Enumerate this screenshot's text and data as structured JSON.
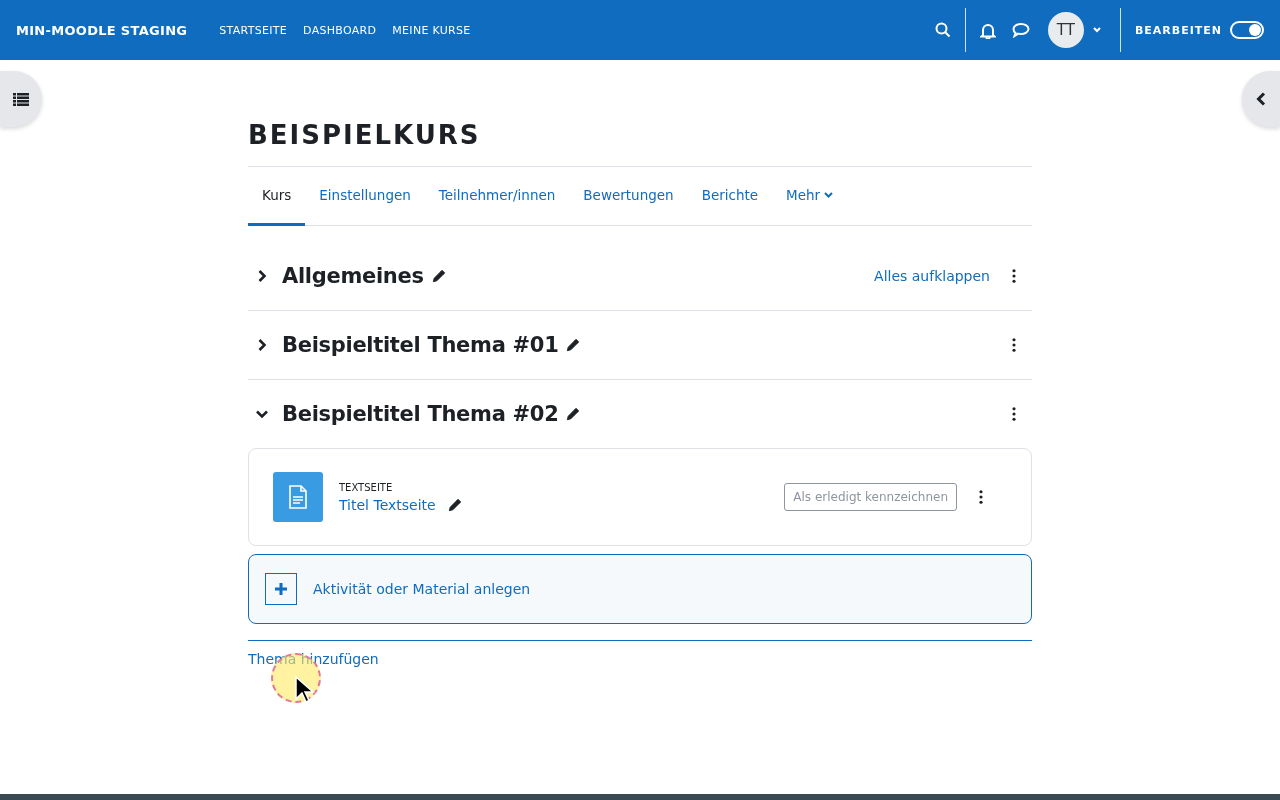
{
  "navbar": {
    "site_name": "MIN-MOODLE STAGING",
    "links": [
      "STARTSEITE",
      "DASHBOARD",
      "MEINE KURSE"
    ],
    "avatar": "TT",
    "edit_mode": {
      "label": "BEARBEITEN",
      "on": true
    }
  },
  "course": {
    "title": "BEISPIELKURS"
  },
  "tabs": [
    {
      "label": "Kurs",
      "selected": true,
      "has_menu": false
    },
    {
      "label": "Einstellungen",
      "selected": false,
      "has_menu": false
    },
    {
      "label": "Teilnehmer/innen",
      "selected": false,
      "has_menu": false
    },
    {
      "label": "Bewertungen",
      "selected": false,
      "has_menu": false
    },
    {
      "label": "Berichte",
      "selected": false,
      "has_menu": false
    },
    {
      "label": "Mehr",
      "selected": false,
      "has_menu": true
    }
  ],
  "expand_all": "Alles aufklappen",
  "sections": [
    {
      "title": "Allgemeines",
      "expanded": false
    },
    {
      "title": "Beispieltitel Thema #01",
      "expanded": false
    },
    {
      "title": "Beispieltitel Thema #02",
      "expanded": true,
      "activities": [
        {
          "type": "TEXTSEITE",
          "name": "Titel Textseite",
          "completion": "Als erledigt kennzeichnen"
        }
      ],
      "add_activity": "Aktivität oder Material anlegen"
    }
  ],
  "add_section": "Thema hinzufügen"
}
